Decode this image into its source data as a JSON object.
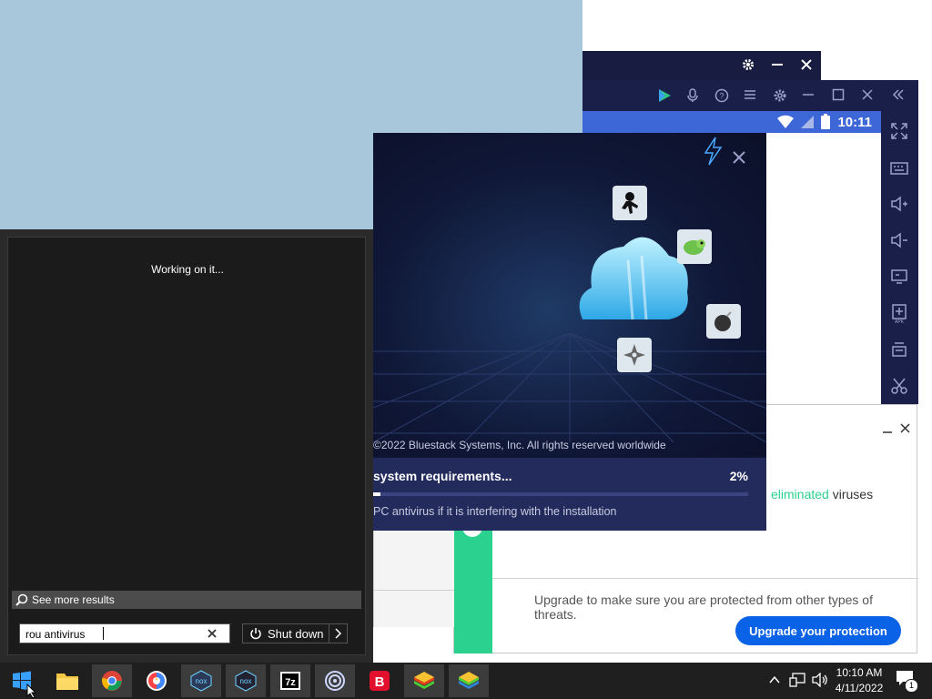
{
  "colors": {
    "accent_green": "#2bd18f",
    "upgrade_blue": "#0a62e6",
    "bluestacks_blue": "#3d66d6"
  },
  "installer": {
    "copyright": "©2022 Bluestack Systems, Inc. All rights reserved worldwide",
    "step": "system requirements...",
    "percent_label": "2%",
    "progress": 0.02,
    "note": "PC antivirus if it is interfering with the installation"
  },
  "bluestacks": {
    "time": "10:11"
  },
  "antivirus": {
    "eliminated_word": "eliminated",
    "viruses_word": "viruses",
    "upgrade_text": "Upgrade to make sure you are protected from other types of threats.",
    "upgrade_button": "Upgrade your protection"
  },
  "start_menu": {
    "status": "Working on it...",
    "see_more": "See more results",
    "search_value": "rou antivirus",
    "shutdown_label": "Shut down"
  },
  "taskbar": {
    "time": "10:10 AM",
    "date": "4/11/2022",
    "notification_count": "1",
    "apps": [
      {
        "name": "file-explorer-icon"
      },
      {
        "name": "chrome-icon"
      },
      {
        "name": "brave-icon"
      },
      {
        "name": "nox-icon"
      },
      {
        "name": "nox-multi-icon"
      },
      {
        "name": "7zip-icon"
      },
      {
        "name": "cortana-icon"
      },
      {
        "name": "bitdefender-icon"
      },
      {
        "name": "bluestacks-icon"
      },
      {
        "name": "bluestacks-multi-icon"
      }
    ],
    "labels": {
      "seven_zip": "7z",
      "bitdefender": "B",
      "nox": "nox"
    }
  }
}
